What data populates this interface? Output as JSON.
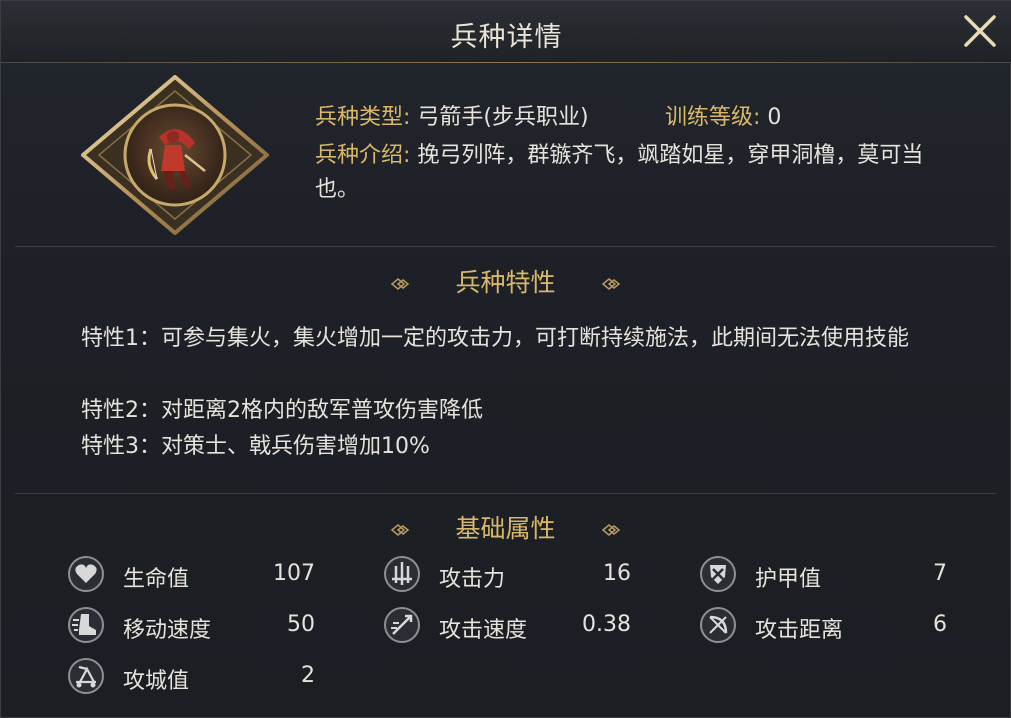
{
  "header": {
    "title": "兵种详情"
  },
  "unit": {
    "type_label": "兵种类型:",
    "type_value": "弓箭手(步兵职业)",
    "level_label": "训练等级:",
    "level_value": "0",
    "intro_label": "兵种介绍:",
    "intro_value": "挽弓列阵，群镞齐飞，飒踏如星，穿甲洞橹，莫可当也。"
  },
  "traits_section": {
    "title": "兵种特性",
    "traits": [
      "特性1：可参与集火，集火增加一定的攻击力，可打断持续施法，此期间无法使用技能",
      "特性2：对距离2格内的敌军普攻伤害降低",
      "特性3：对策士、戟兵伤害增加10%"
    ]
  },
  "stats_section": {
    "title": "基础属性",
    "stats": [
      {
        "icon": "heart-icon",
        "label": "生命值",
        "value": "107"
      },
      {
        "icon": "attack-icon",
        "label": "攻击力",
        "value": "16"
      },
      {
        "icon": "shield-icon",
        "label": "护甲值",
        "value": "7"
      },
      {
        "icon": "boot-icon",
        "label": "移动速度",
        "value": "50"
      },
      {
        "icon": "attack-speed-icon",
        "label": "攻击速度",
        "value": "0.38"
      },
      {
        "icon": "bow-range-icon",
        "label": "攻击距离",
        "value": "6"
      },
      {
        "icon": "catapult-icon",
        "label": "攻城值",
        "value": "2"
      }
    ]
  },
  "colors": {
    "gold": "#d9b86a",
    "text": "#e6e3dc",
    "background": "#1d2026"
  }
}
